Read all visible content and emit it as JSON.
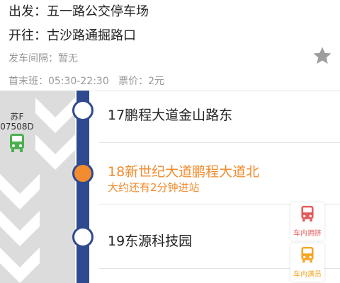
{
  "route": {
    "from_label": "出发：",
    "from_value": "五一路公交停车场",
    "to_label": "开往：",
    "to_value": "古沙路通掘路口",
    "interval": "发车间隔：暂无",
    "hours": "首末班：05:30-22:30",
    "fare": "票价：2元"
  },
  "bus": {
    "plate_line1": "苏F",
    "plate_line2": "07508D",
    "color": "#4caf50"
  },
  "stops": [
    {
      "name": "17鹏程大道金山路东",
      "active": false
    },
    {
      "name": "18新世纪大道鹏程大道北",
      "active": true,
      "eta": "大约还有2分钟进站"
    },
    {
      "name": "19东源科技园",
      "active": false
    }
  ],
  "legend": [
    {
      "label": "车内拥挤",
      "color": "#e55b5b"
    },
    {
      "label": "车内满员",
      "color": "#f5a623"
    }
  ],
  "colors": {
    "line": "#2f4a8f",
    "active": "#f28c2f",
    "lane": "#dcdcdc"
  }
}
